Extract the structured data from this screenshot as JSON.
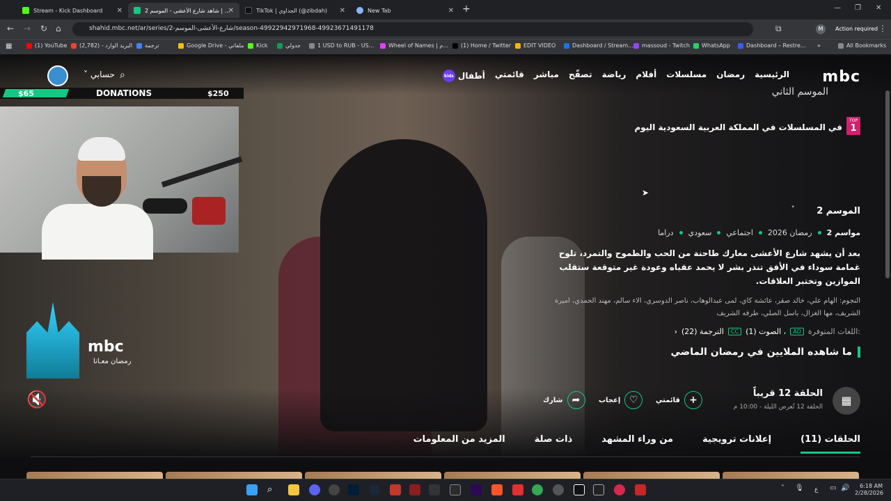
{
  "browser": {
    "tabs": [
      {
        "label": "Stream - Kick Dashboard",
        "color": "#53fc18",
        "active": false
      },
      {
        "label": "شاهد شارع الأعشى - الموسم 2 | ...",
        "color": "#16c784",
        "active": true
      },
      {
        "label": "TikTok | الجداوي (@zibdah)",
        "color": "#111111",
        "active": false
      },
      {
        "label": "New Tab",
        "color": "#8ab4f8",
        "active": false
      }
    ],
    "url": "shahid.mbc.net/ar/series/2-شارع-الأعشى-الموسم/season-49922942971968-49923671491178",
    "action_required": "Action required",
    "profile_initial": "M",
    "bookmarks": [
      {
        "label": "(1) YouTube",
        "color": "#ff0000"
      },
      {
        "label": "البريد الوارد - (2,782)",
        "color": "#ea4335"
      },
      {
        "label": "ترجمة",
        "color": "#4285f4"
      },
      {
        "label": "Google Drive - ملفاتي",
        "color": "#fbbc04"
      },
      {
        "label": "Kick",
        "color": "#53fc18"
      },
      {
        "label": "جدولي",
        "color": "#0f9d58"
      },
      {
        "label": "1 USD to RUB - US...",
        "color": "#888888"
      },
      {
        "label": "Wheel of Names | م...",
        "color": "#e040fb"
      },
      {
        "label": "(1) Home / Twitter",
        "color": "#000000"
      },
      {
        "label": "EDIT VIDEO",
        "color": "#f4b400"
      },
      {
        "label": "Dashboard / Stream...",
        "color": "#1a73e8"
      },
      {
        "label": "massoud - Twitch",
        "color": "#9146ff"
      },
      {
        "label": "WhatsApp",
        "color": "#25d366"
      },
      {
        "label": "Dashboard – Restre...",
        "color": "#3d5afe"
      }
    ],
    "all_bookmarks": "All Bookmarks"
  },
  "site": {
    "logo": "mbc",
    "nav": [
      "الرئيسية",
      "رمضان",
      "مسلسلات",
      "أفلام",
      "رياضة",
      "تصفّح",
      "مباشر",
      "قائمتي",
      "أطفال"
    ],
    "kids_badge": "kids",
    "account": "حسابي",
    "title_art": "الموسم الثاني",
    "top_badge_top": "TOP",
    "top_badge_num": "1",
    "top_text": "في المسلسلات في المملكة العربية السعودية اليوم",
    "season": "الموسم 2",
    "meta": [
      "2 مواسم",
      "رمضان 2026",
      "اجتماعي",
      "سعودي",
      "دراما"
    ],
    "description": "بعد أن يشهد شارع الأعشى معارك طاحنة من الحب والطموح والتمرد، تلوح غمامة سوداء في الأفق تنذر بشر لا يحمد عقباه وعودة غير متوقعة ستقلب الموازين وتختبر العلاقات.",
    "cast": "النجوم: الهام علي، خالد صقر، عائشة كاي، لمى عبدالوهاب، ناصر الدوسري، الاء سالم، مهند الحمدي، اميرة الشريف، مها الغزال، باسل الصلي، طرفه الشريف",
    "languages_label": "اللغات المتوفرة:",
    "audio": "الصوت (1) ،",
    "subtitles": "الترجمة (22)",
    "tag_ad": "AD",
    "tag_cc": "CC",
    "millions": "ما شاهده الملايين في رمضان الماضي",
    "episode_title": "الحلقة 12 قريباً",
    "episode_sub": "الحلقة 12 تُعرض الليلة - 10:00 م",
    "actions": {
      "mylist": "قائمتي",
      "like": "إعجاب",
      "share": "شارك"
    },
    "tabs": [
      "الحلقات (11)",
      "إعلانات ترويجية",
      "من وراء المشهد",
      "ذات صلة",
      "المزيد من المعلومات"
    ],
    "ramadan_logo": {
      "main": "mbc",
      "sub": "رمضان معـانا"
    }
  },
  "overlay": {
    "donation_left": "$65",
    "donation_label": "DONATIONS",
    "donation_right": "$250",
    "donation_progress": 0.26
  },
  "taskbar": {
    "time": "6:18 AM",
    "date": "2/28/2026",
    "lang": "ع"
  }
}
